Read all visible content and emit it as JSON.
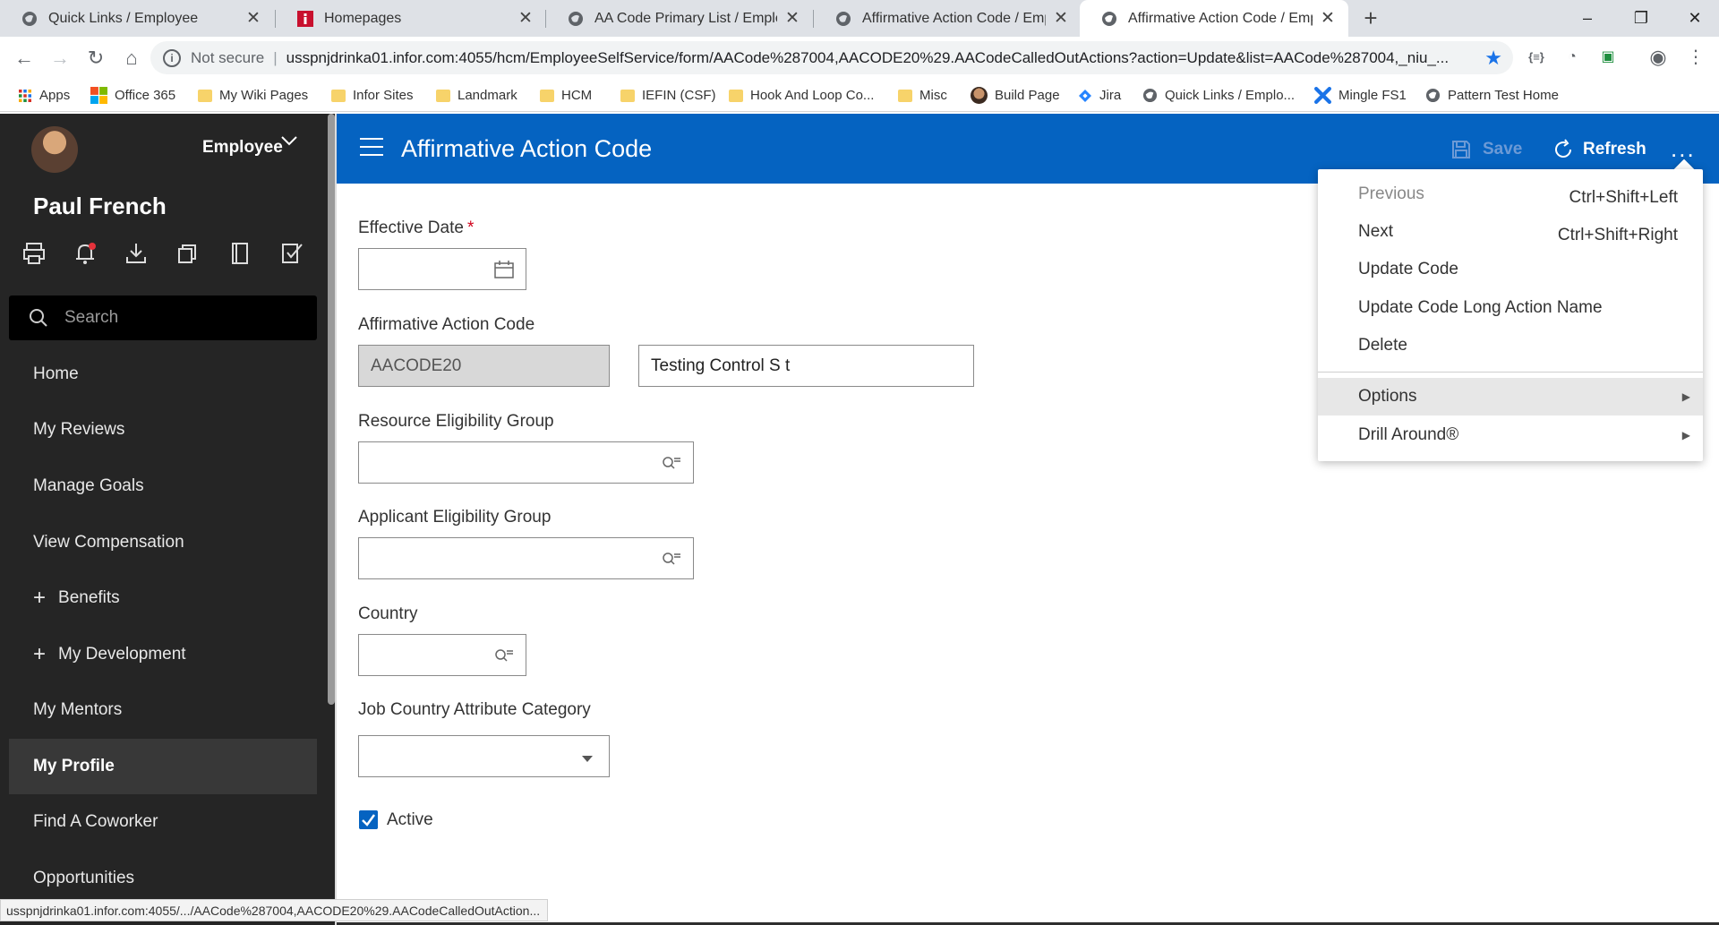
{
  "browser": {
    "tabs": [
      {
        "title": "Quick Links / Employee",
        "icon": "globe-icon"
      },
      {
        "title": "Homepages",
        "icon": "infor-icon"
      },
      {
        "title": "AA Code Primary List / Employee",
        "icon": "globe-icon"
      },
      {
        "title": "Affirmative Action Code / Employ",
        "icon": "globe-icon"
      },
      {
        "title": "Affirmative Action Code / Employ",
        "icon": "globe-icon"
      }
    ],
    "new_tab": "+",
    "window_controls": {
      "minimize": "–",
      "maximize": "❐",
      "close": "✕"
    },
    "security_label": "Not secure",
    "url": "usspnjdrinka01.infor.com:4055/hcm/EmployeeSelfService/form/AACode%287004,AACODE20%29.AACodeCalledOutActions?action=Update&list=AACode%287004,_niu_...",
    "bookmarks": [
      {
        "label": "Apps",
        "icon": "apps-grid-icon"
      },
      {
        "label": "Office 365",
        "icon": "office-icon"
      },
      {
        "label": "My Wiki Pages",
        "icon": "folder-icon"
      },
      {
        "label": "Infor Sites",
        "icon": "folder-icon"
      },
      {
        "label": "Landmark",
        "icon": "folder-icon"
      },
      {
        "label": "HCM",
        "icon": "folder-icon"
      },
      {
        "label": "IEFIN (CSF)",
        "icon": "folder-icon"
      },
      {
        "label": "Hook And Loop Co...",
        "icon": "folder-icon"
      },
      {
        "label": "Misc",
        "icon": "folder-icon"
      },
      {
        "label": "Build Page",
        "icon": "avatar-icon"
      },
      {
        "label": "Jira",
        "icon": "jira-icon"
      },
      {
        "label": "Quick Links / Emplo...",
        "icon": "globe-icon"
      },
      {
        "label": "Mingle FS1",
        "icon": "mingle-icon"
      },
      {
        "label": "Pattern Test Home",
        "icon": "globe-icon"
      }
    ],
    "status_url": "usspnjdrinka01.infor.com:4055/.../AACode%287004,AACODE20%29.AACodeCalledOutAction..."
  },
  "sidebar": {
    "role": "Employee",
    "user_name": "Paul French",
    "search_placeholder": "Search",
    "items": [
      {
        "label": "Home"
      },
      {
        "label": "My Reviews"
      },
      {
        "label": "Manage Goals"
      },
      {
        "label": "View Compensation"
      },
      {
        "label": "Benefits",
        "expandable": "+"
      },
      {
        "label": "My Development",
        "expandable": "+"
      },
      {
        "label": "My Mentors"
      },
      {
        "label": "My Profile",
        "selected": true
      },
      {
        "label": "Find A Coworker"
      },
      {
        "label": "Opportunities"
      }
    ]
  },
  "header": {
    "title": "Affirmative Action Code",
    "save_label": "Save",
    "refresh_label": "Refresh",
    "more_label": "..."
  },
  "form": {
    "effective_date": {
      "label": "Effective Date",
      "required": "*",
      "value": ""
    },
    "aa_code": {
      "label": "Affirmative Action Code",
      "code": "AACODE20",
      "description": "Testing Control S t"
    },
    "resource_group": {
      "label": "Resource Eligibility Group",
      "value": ""
    },
    "applicant_group": {
      "label": "Applicant Eligibility Group",
      "value": ""
    },
    "country": {
      "label": "Country",
      "value": ""
    },
    "job_country_category": {
      "label": "Job Country Attribute Category",
      "value": ""
    },
    "active": {
      "label": "Active",
      "checked": true
    }
  },
  "menu": {
    "items": [
      {
        "label": "Previous",
        "shortcut": "Ctrl+Shift+Left",
        "disabled": true
      },
      {
        "label": "Next",
        "shortcut": "Ctrl+Shift+Right"
      },
      {
        "label": "Update Code"
      },
      {
        "label": "Update Code Long Action Name"
      },
      {
        "label": "Delete"
      },
      {
        "label": "Options",
        "submenu": "▶"
      },
      {
        "label": "Drill Around®",
        "submenu": "▶"
      }
    ]
  },
  "colors": {
    "header_blue": "#0563c1",
    "sidebar_bg": "#252525",
    "required_red": "#d0021b"
  }
}
